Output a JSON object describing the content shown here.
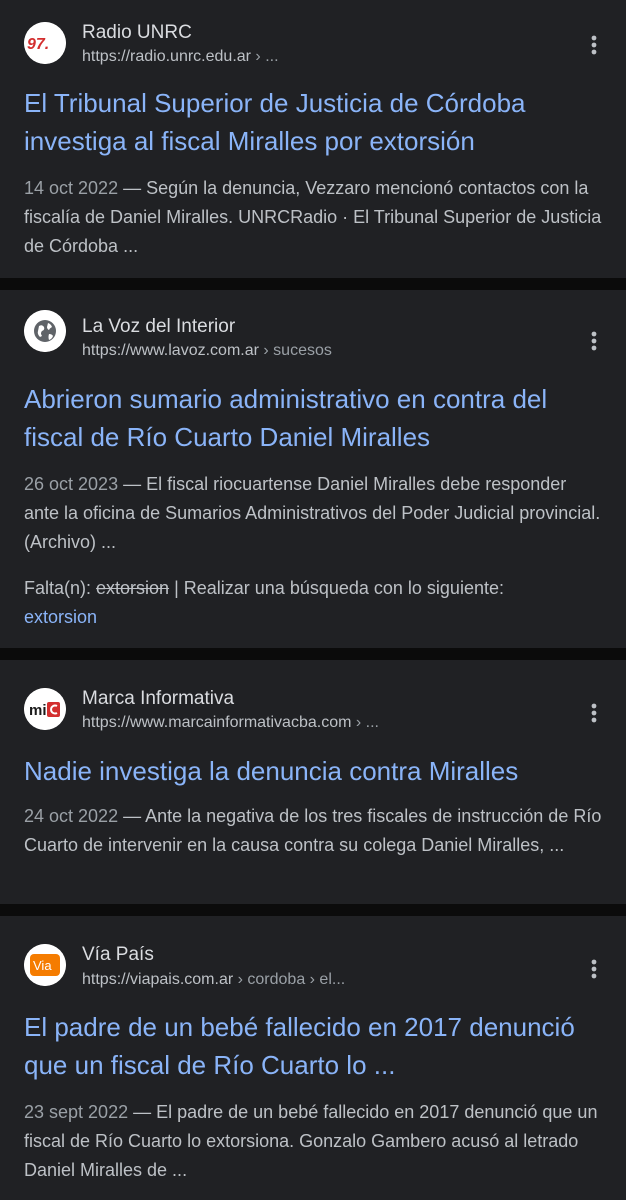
{
  "results": [
    {
      "site_name": "Radio UNRC",
      "url_base": "https://radio.unrc.edu.ar",
      "url_path": " › ...",
      "favicon_text": "97.",
      "title": "El Tribunal Superior de Justicia de Córdoba investiga al fiscal Miralles por extorsión",
      "date": "14 oct 2022",
      "snippet": " — Según la denuncia, Vezzaro mencionó contactos con la fiscalía de Daniel Miralles. UNRCRadio · El Tribunal Superior de Justicia de Córdoba ..."
    },
    {
      "site_name": "La Voz del Interior",
      "url_base": "https://www.lavoz.com.ar",
      "url_path": " › sucesos",
      "title": "Abrieron sumario administrativo en contra del fiscal de Río Cuarto Daniel Miralles",
      "date": "26 oct 2023",
      "snippet": " — El fiscal riocuartense Daniel Miralles debe responder ante la oficina de Sumarios Administrativos del Poder Judicial provincial. (Archivo) ...",
      "missing_label": "Falta(n): ",
      "missing_term": "extorsion",
      "missing_sep": " | Realizar una búsqueda con lo siguiente:",
      "missing_link": "extorsion"
    },
    {
      "site_name": "Marca Informativa",
      "url_base": "https://www.marcainformativacba.com",
      "url_path": " › ...",
      "favicon_text": "mi",
      "title": "Nadie investiga la denuncia contra Miralles",
      "date": "24 oct 2022",
      "snippet": " — Ante la negativa de los tres fiscales de instrucción de Río Cuarto de intervenir en la causa contra su colega Daniel Miralles, ..."
    },
    {
      "site_name": "Vía País",
      "url_base": "https://viapais.com.ar",
      "url_path": " › cordoba › el...",
      "favicon_text": "Via",
      "title": "El padre de un bebé fallecido en 2017 denunció que un fiscal de Río Cuarto lo ...",
      "date": "23 sept 2022",
      "snippet": " — El padre de un bebé fallecido en 2017 denunció que un fiscal de Río Cuarto lo extorsiona. Gonzalo Gambero acusó al letrado Daniel Miralles de ..."
    }
  ],
  "colors": {
    "background": "#0b0b0b",
    "card": "#202124",
    "link": "#8ab4f8",
    "text": "#bdc1c6"
  },
  "icons": [
    "radio-unrc-favicon-icon",
    "globe-icon",
    "marca-informativa-favicon-icon",
    "via-pais-favicon-icon",
    "more-vert-icon"
  ]
}
